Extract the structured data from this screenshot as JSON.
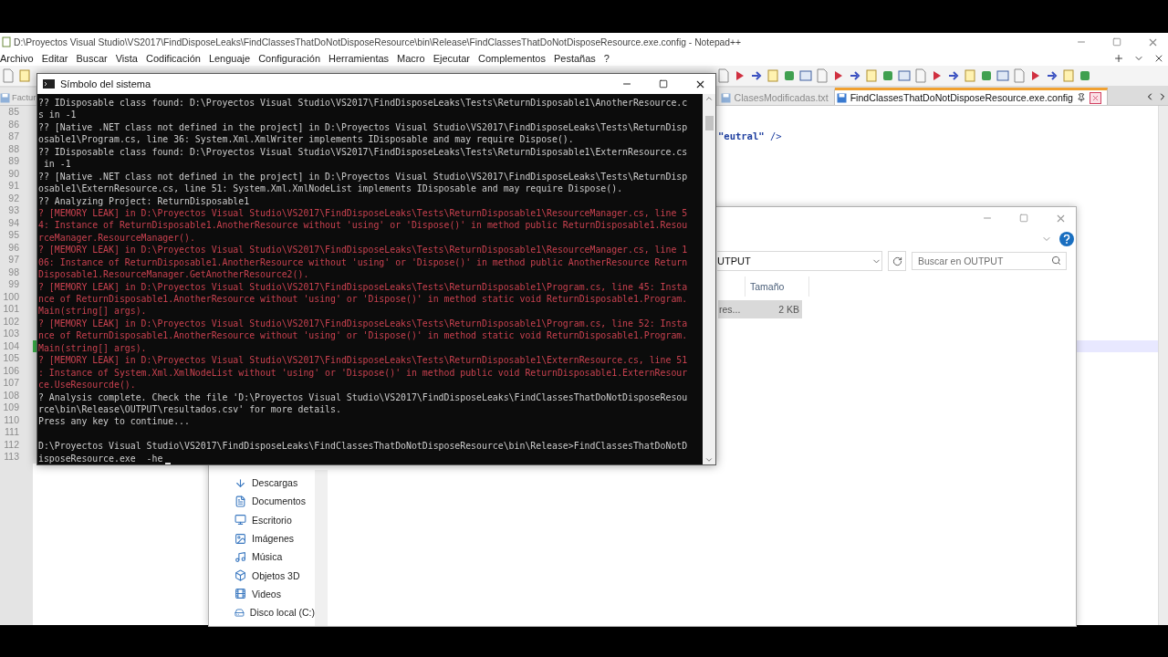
{
  "notepad": {
    "title": "D:\\Proyectos Visual Studio\\VS2017\\FindDisposeLeaks\\FindClassesThatDoNotDisposeResource\\bin\\Release\\FindClassesThatDoNotDisposeResource.exe.config - Notepad++",
    "menu": [
      "Archivo",
      "Editar",
      "Buscar",
      "Vista",
      "Codificación",
      "Lenguaje",
      "Configuración",
      "Herramientas",
      "Macro",
      "Ejecutar",
      "Complementos",
      "Pestañas",
      "?"
    ],
    "tabs": [
      {
        "label": "Factur",
        "selected": false
      },
      {
        "label": "ClasesModificadas.txt",
        "selected": false
      },
      {
        "label": "FindClassesThatDoNotDisposeResource.exe.config",
        "selected": true
      }
    ],
    "editor": {
      "lines": [
        {
          "number": "85",
          "current": false
        },
        {
          "number": "86",
          "current": false
        },
        {
          "number": "87",
          "current": false,
          "text": "**\"eutral\"** />"
        },
        {
          "number": "88",
          "current": false
        },
        {
          "number": "89",
          "current": false
        },
        {
          "number": "90",
          "current": false
        },
        {
          "number": "91",
          "current": false
        },
        {
          "number": "92",
          "current": false
        },
        {
          "number": "93",
          "current": false
        },
        {
          "number": "94",
          "current": false
        },
        {
          "number": "95",
          "current": false
        },
        {
          "number": "96",
          "current": false
        },
        {
          "number": "97",
          "current": false
        },
        {
          "number": "98",
          "current": false
        },
        {
          "number": "99",
          "current": false
        },
        {
          "number": "100",
          "current": false
        },
        {
          "number": "101",
          "current": false
        },
        {
          "number": "102",
          "current": false
        },
        {
          "number": "103",
          "current": false
        },
        {
          "number": "104",
          "current": true
        },
        {
          "number": "105",
          "current": false
        },
        {
          "number": "106",
          "current": false
        },
        {
          "number": "107",
          "current": false
        },
        {
          "number": "108",
          "current": false
        },
        {
          "number": "109",
          "current": false
        },
        {
          "number": "110",
          "current": false
        },
        {
          "number": "111",
          "current": false
        },
        {
          "number": "112",
          "current": false
        },
        {
          "number": "113",
          "current": false
        }
      ]
    }
  },
  "explorer": {
    "address": "UTPUT",
    "search": {
      "placeholder": "Buscar en OUTPUT"
    },
    "columns": [
      "Tamaño"
    ],
    "files": [
      {
        "name": "res...",
        "size": "2 KB",
        "selected": true
      }
    ],
    "nav_items": [
      "Descargas",
      "Documentos",
      "Escritorio",
      "Imágenes",
      "Música",
      "Objetos 3D",
      "Videos",
      "Disco local (C:)"
    ]
  },
  "console": {
    "title": "Símbolo del sistema",
    "lines": [
      {
        "kind": "info",
        "text": "?? IDisposable class found: D:\\Proyectos Visual Studio\\VS2017\\FindDisposeLeaks\\Tests\\ReturnDisposable1\\AnotherResource.c"
      },
      {
        "kind": "info",
        "text": "s in -1"
      },
      {
        "kind": "info",
        "text": "?? [Native .NET class not defined in the project] in D:\\Proyectos Visual Studio\\VS2017\\FindDisposeLeaks\\Tests\\ReturnDisp"
      },
      {
        "kind": "info",
        "text": "osable1\\Program.cs, line 36: System.Xml.XmlWriter implements IDisposable and may require Dispose()."
      },
      {
        "kind": "info",
        "text": "?? IDisposable class found: D:\\Proyectos Visual Studio\\VS2017\\FindDisposeLeaks\\Tests\\ReturnDisposable1\\ExternResource.cs"
      },
      {
        "kind": "info",
        "text": " in -1"
      },
      {
        "kind": "info",
        "text": "?? [Native .NET class not defined in the project] in D:\\Proyectos Visual Studio\\VS2017\\FindDisposeLeaks\\Tests\\ReturnDisp"
      },
      {
        "kind": "info",
        "text": "osable1\\ExternResource.cs, line 51: System.Xml.XmlNodeList implements IDisposable and may require Dispose()."
      },
      {
        "kind": "info",
        "text": "?? Analyzing Project: ReturnDisposable1"
      },
      {
        "kind": "leak",
        "text": "? [MEMORY LEAK] in D:\\Proyectos Visual Studio\\VS2017\\FindDisposeLeaks\\Tests\\ReturnDisposable1\\ResourceManager.cs, line 5"
      },
      {
        "kind": "leak",
        "text": "4: Instance of ReturnDisposable1.AnotherResource without 'using' or 'Dispose()' in method public ReturnDisposable1.Resou"
      },
      {
        "kind": "leak",
        "text": "rceManager.ResourceManager()."
      },
      {
        "kind": "leak",
        "text": "? [MEMORY LEAK] in D:\\Proyectos Visual Studio\\VS2017\\FindDisposeLeaks\\Tests\\ReturnDisposable1\\ResourceManager.cs, line 1"
      },
      {
        "kind": "leak",
        "text": "06: Instance of ReturnDisposable1.AnotherResource without 'using' or 'Dispose()' in method public AnotherResource Return"
      },
      {
        "kind": "leak",
        "text": "Disposable1.ResourceManager.GetAnotherResource2()."
      },
      {
        "kind": "leak",
        "text": "? [MEMORY LEAK] in D:\\Proyectos Visual Studio\\VS2017\\FindDisposeLeaks\\Tests\\ReturnDisposable1\\Program.cs, line 45: Insta"
      },
      {
        "kind": "leak",
        "text": "nce of ReturnDisposable1.AnotherResource without 'using' or 'Dispose()' in method static void ReturnDisposable1.Program."
      },
      {
        "kind": "leak",
        "text": "Main(string[] args)."
      },
      {
        "kind": "leak",
        "text": "? [MEMORY LEAK] in D:\\Proyectos Visual Studio\\VS2017\\FindDisposeLeaks\\Tests\\ReturnDisposable1\\Program.cs, line 52: Insta"
      },
      {
        "kind": "leak",
        "text": "nce of ReturnDisposable1.AnotherResource without 'using' or 'Dispose()' in method static void ReturnDisposable1.Program."
      },
      {
        "kind": "leak",
        "text": "Main(string[] args)."
      },
      {
        "kind": "leak",
        "text": "? [MEMORY LEAK] in D:\\Proyectos Visual Studio\\VS2017\\FindDisposeLeaks\\Tests\\ReturnDisposable1\\ExternResource.cs, line 51"
      },
      {
        "kind": "leak",
        "text": ": Instance of System.Xml.XmlNodeList without 'using' or 'Dispose()' in method public void ReturnDisposable1.ExternResour"
      },
      {
        "kind": "leak",
        "text": "ce.UseResourcde()."
      },
      {
        "kind": "info",
        "text": "? Analysis complete. Check the file 'D:\\Proyectos Visual Studio\\VS2017\\FindDisposeLeaks\\FindClassesThatDoNotDisposeResou"
      },
      {
        "kind": "info",
        "text": "rce\\bin\\Release\\OUTPUT\\resultados.csv' for more details."
      },
      {
        "kind": "info",
        "text": "Press any key to continue..."
      }
    ],
    "prompt": [
      "D:\\Proyectos Visual Studio\\VS2017\\FindDisposeLeaks\\FindClassesThatDoNotDisposeResource\\bin\\Release>FindClassesThatDoNotD",
      "isposeResource.exe  -he"
    ]
  }
}
